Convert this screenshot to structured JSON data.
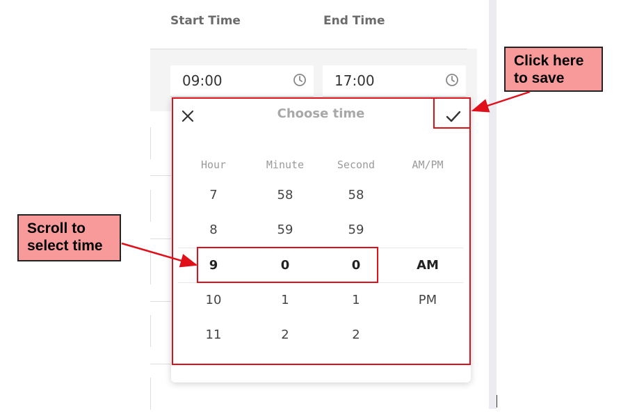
{
  "headers": {
    "start_time": "Start Time",
    "end_time": "End Time"
  },
  "fields": {
    "start_value": "09:00",
    "end_value": "17:00"
  },
  "picker": {
    "title": "Choose time",
    "columns": [
      "Hour",
      "Minute",
      "Second",
      "AM/PM"
    ],
    "hour": [
      "7",
      "8",
      "9",
      "10",
      "11"
    ],
    "minute": [
      "58",
      "59",
      "0",
      "1",
      "2"
    ],
    "second": [
      "58",
      "59",
      "0",
      "1",
      "2"
    ],
    "ampm": [
      "AM",
      "PM"
    ],
    "selected": {
      "hour": "9",
      "minute": "0",
      "second": "0",
      "ampm": "AM"
    }
  },
  "annotations": {
    "save_callout": [
      "Click here",
      "to save"
    ],
    "scroll_callout": [
      "Scroll to",
      "select time"
    ],
    "annotation_color": "#e0101a",
    "callout_fill": "#f99a9a"
  },
  "icons": [
    "clock-icon",
    "close-icon",
    "check-icon"
  ]
}
